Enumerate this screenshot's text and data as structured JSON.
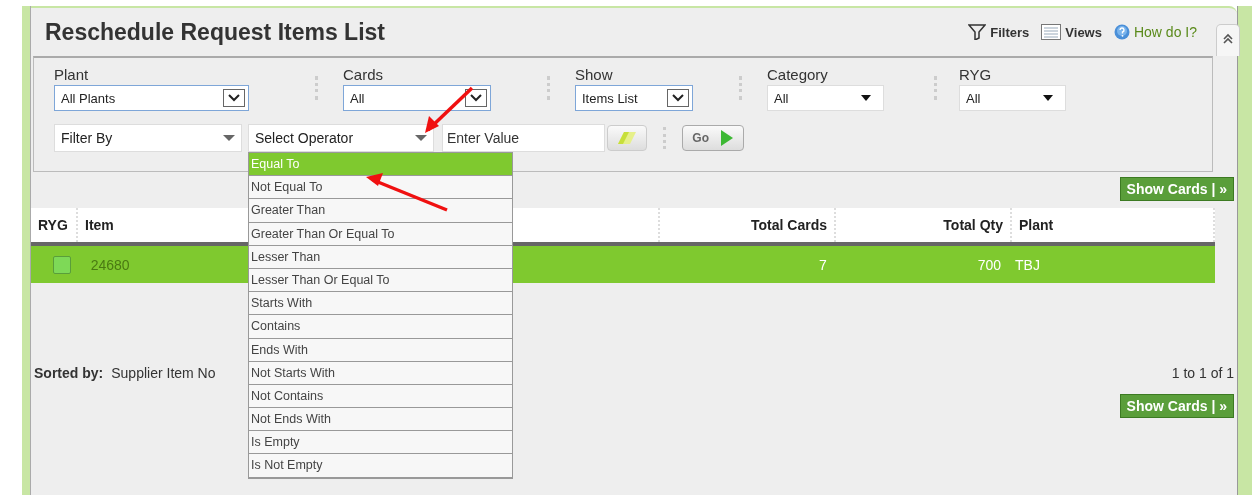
{
  "title": "Reschedule Request Items List",
  "toolbar": [
    {
      "kind": "filter",
      "label": "Filters"
    },
    {
      "kind": "views",
      "label": "Views"
    },
    {
      "kind": "help",
      "label": "How do I?"
    }
  ],
  "filters": [
    {
      "label": "Plant",
      "value": "All Plants",
      "kind": "box"
    },
    {
      "label": "Cards",
      "value": "All",
      "kind": "box"
    },
    {
      "label": "Show",
      "value": "Items List",
      "kind": "box"
    },
    {
      "label": "Category",
      "value": "All",
      "kind": "plain"
    },
    {
      "label": "RYG",
      "value": "All",
      "kind": "plain"
    }
  ],
  "filter_by": {
    "value": "Filter By"
  },
  "operator": {
    "value": "Select Operator",
    "expanded": true,
    "options": [
      {
        "label": "Equal To",
        "selected": true
      },
      {
        "label": "Not Equal To",
        "selected": false
      },
      {
        "label": "Greater Than",
        "selected": false
      },
      {
        "label": "Greater Than Or Equal To",
        "selected": false
      },
      {
        "label": "Lesser Than",
        "selected": false
      },
      {
        "label": "Lesser Than Or Equal To",
        "selected": false
      },
      {
        "label": "Starts With",
        "selected": false
      },
      {
        "label": "Contains",
        "selected": false
      },
      {
        "label": "Ends With",
        "selected": false
      },
      {
        "label": "Not Starts With",
        "selected": false
      },
      {
        "label": "Not Contains",
        "selected": false
      },
      {
        "label": "Not Ends With",
        "selected": false
      },
      {
        "label": "Is Empty",
        "selected": false
      },
      {
        "label": "Is Not Empty",
        "selected": false
      }
    ]
  },
  "value_field": {
    "placeholder": "Enter Value"
  },
  "go_button": "Go",
  "show_cards_top": "Show Cards | »",
  "table": {
    "columns": [
      "RYG",
      "Item",
      "Total Cards",
      "Total Qty",
      "Plant"
    ],
    "rows": [
      {
        "selected": true,
        "cells": [
          {
            "kind": "status",
            "color": "#7ed957"
          },
          {
            "kind": "text",
            "text": "24680"
          },
          {
            "kind": "text",
            "text": "7"
          },
          {
            "kind": "text",
            "text": "700"
          },
          {
            "kind": "text",
            "text": "TBJ"
          }
        ]
      }
    ]
  },
  "sorted_by": {
    "label": "Sorted by:",
    "value": "Supplier Item No"
  },
  "pagination": "1 to 1 of 1",
  "show_cards_bottom": "Show Cards | »"
}
